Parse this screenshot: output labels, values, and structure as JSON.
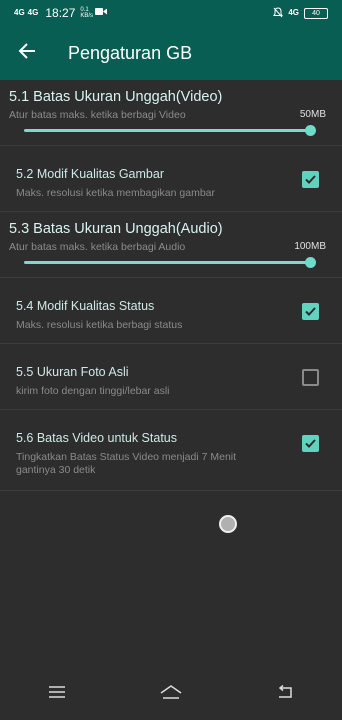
{
  "status_bar": {
    "net1": "4G",
    "net2": "4G",
    "time": "18:27",
    "speed": "0.1 KB/s",
    "net3": "4G",
    "battery": "40"
  },
  "app_bar": {
    "title": "Pengaturan GB",
    "back_icon": "arrow-left-icon"
  },
  "preferences": {
    "video_limit": {
      "title": "5.1 Batas Ukuran Unggah(Video)",
      "summary": "Atur batas maks. ketika berbagi Video",
      "value": "50MB",
      "slider_fraction": 1.0
    },
    "image_quality": {
      "title": "5.2 Modif Kualitas Gambar",
      "summary": "Maks. resolusi ketika membagikan gambar",
      "checked": true
    },
    "audio_limit": {
      "title": "5.3 Batas Ukuran Unggah(Audio)",
      "summary": "Atur batas maks. ketika berbagi Audio",
      "value": "100MB",
      "slider_fraction": 1.0
    },
    "status_quality": {
      "title": "5.4 Modif Kualitas Status",
      "summary": "Maks. resolusi ketika berbagi status",
      "checked": true
    },
    "original_photo": {
      "title": "5.5 Ukuran Foto Asli",
      "summary": "kirim foto dengan tinggi/lebar asli",
      "checked": false
    },
    "status_video_limit": {
      "title": "5.6 Batas Video untuk Status",
      "summary": "Tingkatkan Batas Status Video menjadi 7 Menit gantinya 30 detik",
      "checked": true
    }
  },
  "colors": {
    "app_bar": "#095e54",
    "accent": "#5fd3bf",
    "background": "#2d2d2d"
  },
  "nav_bar": {
    "menu_icon": "menu-icon",
    "home_icon": "home-icon",
    "back_icon": "back-icon"
  }
}
